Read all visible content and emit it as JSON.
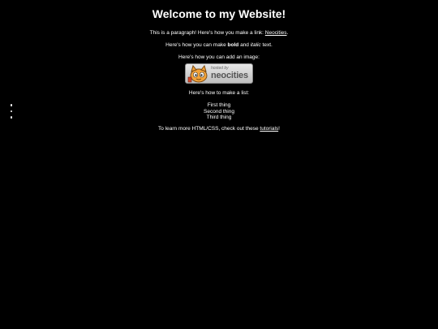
{
  "page": {
    "title": "Welcome to my Website!",
    "paragraph1_before": "This is a paragraph! Here's how you make a link: ",
    "link1_text": "Neocities",
    "paragraph1_after": ".",
    "paragraph2_before": "Here's how you can make ",
    "bold_text": "bold",
    "paragraph2_mid": " and ",
    "italic_text": "italic",
    "paragraph2_after": " text.",
    "paragraph3": "Here's how you can add an image:",
    "badge_small": "hosted by",
    "badge_big": "neocities",
    "paragraph4": "Here's how to make a list:",
    "list_items": [
      "First thing",
      "Second thing",
      "Third thing"
    ],
    "paragraph5_before": "To learn more HTML/CSS, check out these ",
    "link2_text": "tutorials",
    "paragraph5_after": "!"
  }
}
